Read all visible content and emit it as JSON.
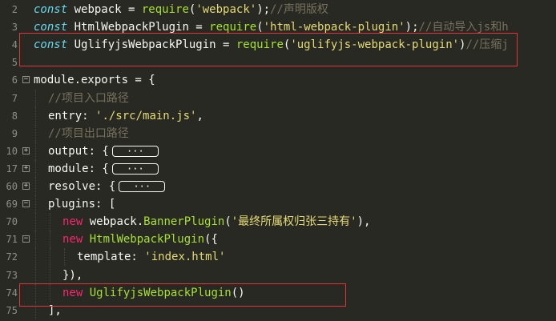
{
  "lines": [
    {
      "num": "2",
      "parts": [
        [
          "kw",
          "const"
        ],
        [
          "t",
          " webpack = "
        ],
        [
          "fn",
          "require"
        ],
        [
          "t",
          "("
        ],
        [
          "str",
          "'webpack'"
        ],
        [
          "t",
          ");"
        ],
        [
          "cm",
          "//声明版权"
        ]
      ]
    },
    {
      "num": "3",
      "parts": [
        [
          "kw",
          "const"
        ],
        [
          "t",
          " HtmlWebpackPlugin = "
        ],
        [
          "fn",
          "require"
        ],
        [
          "t",
          "("
        ],
        [
          "str",
          "'html-webpack-plugin'"
        ],
        [
          "t",
          ");"
        ],
        [
          "cm",
          "//自动导入js和h"
        ]
      ]
    },
    {
      "num": "4",
      "parts": [
        [
          "kw",
          "const"
        ],
        [
          "t",
          " UglifyjsWebpackPlugin = "
        ],
        [
          "fn",
          "require"
        ],
        [
          "t",
          "("
        ],
        [
          "str",
          "'uglifyjs-webpack-plugin'"
        ],
        [
          "t",
          ")"
        ],
        [
          "cm",
          "//压缩j"
        ]
      ]
    },
    {
      "num": "5",
      "parts": []
    },
    {
      "num": "6",
      "fold": "minus",
      "parts": [
        [
          "t",
          "module.exports = {"
        ]
      ]
    },
    {
      "num": "7",
      "indent": 1,
      "parts": [
        [
          "cm",
          "//项目入口路径"
        ]
      ]
    },
    {
      "num": "8",
      "indent": 1,
      "parts": [
        [
          "t",
          "entry: "
        ],
        [
          "str",
          "'./src/main.js'"
        ],
        [
          "t",
          ","
        ]
      ]
    },
    {
      "num": "9",
      "indent": 1,
      "parts": [
        [
          "cm",
          "//项目出口路径"
        ]
      ]
    },
    {
      "num": "10",
      "fold": "plus",
      "indent": 1,
      "parts": [
        [
          "t",
          "output: {"
        ],
        [
          "ell",
          "···"
        ]
      ]
    },
    {
      "num": "17",
      "fold": "plus",
      "indent": 1,
      "parts": [
        [
          "t",
          "module: {"
        ],
        [
          "ell",
          "···"
        ]
      ]
    },
    {
      "num": "60",
      "fold": "plus",
      "indent": 1,
      "parts": [
        [
          "t",
          "resolve: {"
        ],
        [
          "ell",
          "···"
        ]
      ]
    },
    {
      "num": "69",
      "fold": "minus",
      "indent": 1,
      "parts": [
        [
          "t",
          "plugins: ["
        ]
      ]
    },
    {
      "num": "70",
      "indent": 2,
      "parts": [
        [
          "new",
          "new"
        ],
        [
          "t",
          " webpack."
        ],
        [
          "cls",
          "BannerPlugin"
        ],
        [
          "t",
          "("
        ],
        [
          "str",
          "'最终所属权归张三持有'"
        ],
        [
          "t",
          "),"
        ]
      ]
    },
    {
      "num": "71",
      "fold": "minus",
      "indent": 2,
      "parts": [
        [
          "new",
          "new"
        ],
        [
          "t",
          " "
        ],
        [
          "cls",
          "HtmlWebpackPlugin"
        ],
        [
          "t",
          "({"
        ]
      ]
    },
    {
      "num": "72",
      "indent": 3,
      "parts": [
        [
          "t",
          "template: "
        ],
        [
          "str",
          "'index.html'"
        ]
      ]
    },
    {
      "num": "73",
      "indent": 2,
      "parts": [
        [
          "t",
          "}),"
        ]
      ]
    },
    {
      "num": "74",
      "indent": 2,
      "parts": [
        [
          "new",
          "new"
        ],
        [
          "t",
          " "
        ],
        [
          "cls",
          "UglifyjsWebpackPlugin"
        ],
        [
          "t",
          "()"
        ]
      ]
    },
    {
      "num": "75",
      "indent": 1,
      "parts": [
        [
          "t",
          "],"
        ]
      ]
    }
  ],
  "colors": {
    "background": "#282923",
    "highlight": "#e0363b"
  }
}
